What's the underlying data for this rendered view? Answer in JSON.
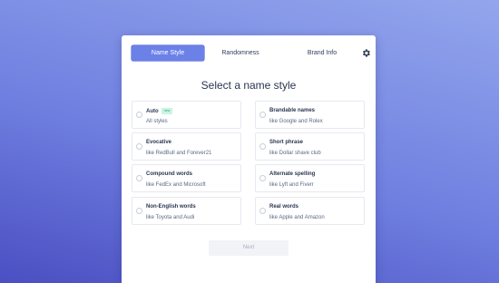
{
  "tabs": [
    {
      "label": "Name Style",
      "active": true
    },
    {
      "label": "Randomness",
      "active": false
    },
    {
      "label": "Brand Info",
      "active": false
    }
  ],
  "settings_icon": "gear-icon",
  "heading": "Select a name style",
  "options": [
    {
      "title": "Auto",
      "badge": "new",
      "subtitle": "All styles"
    },
    {
      "title": "Brandable names",
      "subtitle": "like Google and Rolex"
    },
    {
      "title": "Evocative",
      "subtitle": "like RedBull and Forever21"
    },
    {
      "title": "Short phrase",
      "subtitle": "like Dollar shave club"
    },
    {
      "title": "Compound words",
      "subtitle": "like FedEx and Microsoft"
    },
    {
      "title": "Alternate spelling",
      "subtitle": "like Lyft and Fiverr"
    },
    {
      "title": "Non-English words",
      "subtitle": "like Toyota and Audi"
    },
    {
      "title": "Real words",
      "subtitle": "like Apple and Amazon"
    }
  ],
  "next_label": "Next",
  "colors": {
    "accent": "#6b81e8",
    "badge_bg": "#c8f5e2",
    "badge_text": "#2aa57a",
    "heading": "#2a3550"
  }
}
